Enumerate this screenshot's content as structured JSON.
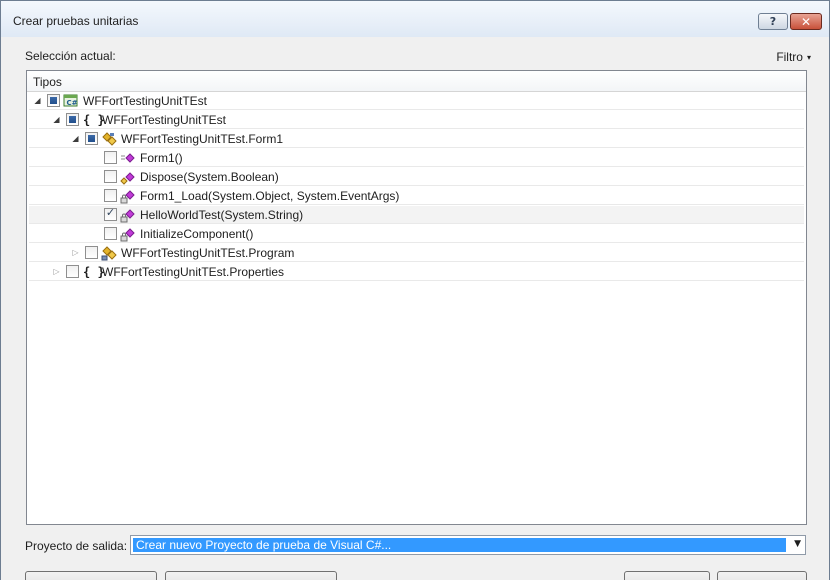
{
  "window": {
    "title": "Crear pruebas unitarias"
  },
  "titlebar": {
    "help": "?",
    "close": "✕"
  },
  "selection": {
    "label": "Selección actual:",
    "filter_label": "Filtro",
    "filter_arrow": "▾"
  },
  "tree": {
    "header": "Tipos",
    "rows": [
      {
        "label": "WFFortTestingUnitTEst",
        "expander": "◢",
        "check": "partial",
        "icon": "csharp-project-icon"
      },
      {
        "label": "WFFortTestingUnitTEst",
        "expander": "◢",
        "check": "partial",
        "icon": "namespace-icon",
        "icon_text": "{ }"
      },
      {
        "label": "WFFortTestingUnitTEst.Form1",
        "expander": "◢",
        "check": "partial",
        "icon": "class-icon"
      },
      {
        "label": "Form1()",
        "check": "unchecked",
        "icon": "constructor-method-icon"
      },
      {
        "label": "Dispose(System.Boolean)",
        "check": "unchecked",
        "icon": "protected-method-icon"
      },
      {
        "label": "Form1_Load(System.Object, System.EventArgs)",
        "check": "unchecked",
        "icon": "private-method-icon"
      },
      {
        "label": "HelloWorldTest(System.String)",
        "check": "checked",
        "icon": "private-method-icon"
      },
      {
        "label": "InitializeComponent()",
        "check": "unchecked",
        "icon": "private-method-icon"
      },
      {
        "label": "WFFortTestingUnitTEst.Program",
        "expander": "▷",
        "check": "unchecked",
        "icon": "static-class-icon"
      },
      {
        "label": "WFFortTestingUnitTEst.Properties",
        "expander": "▷",
        "check": "unchecked",
        "icon": "namespace-icon",
        "icon_text": "{ }"
      }
    ]
  },
  "output": {
    "label": "Proyecto de salida:",
    "value": "Crear nuevo Proyecto de prueba de Visual C#...",
    "arrow": "▼"
  },
  "colors": {
    "selection": "#3399ff",
    "method_icon": "#c13bd8",
    "class_icon": "#e3b32a",
    "check_fill": "#2a5a9c"
  }
}
